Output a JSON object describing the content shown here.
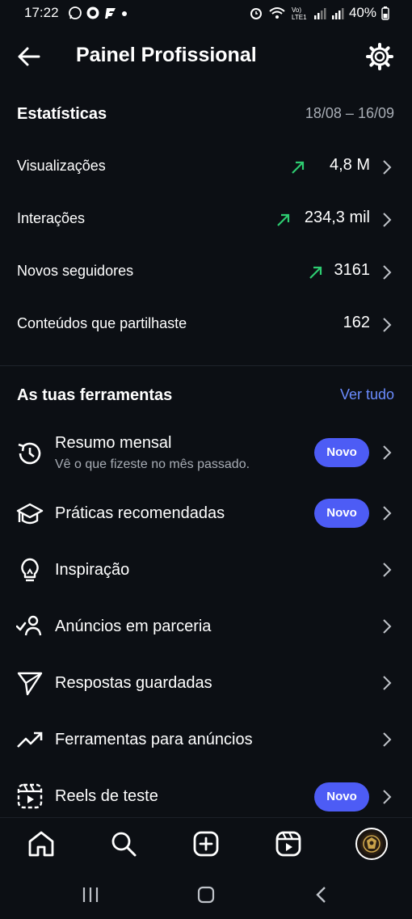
{
  "status_bar": {
    "time": "17:22",
    "battery": "40%"
  },
  "header": {
    "title": "Painel Profissional"
  },
  "stats": {
    "title": "Estatísticas",
    "date_range": "18/08 – 16/09",
    "rows": [
      {
        "label": "Visualizações",
        "value": "4,8 M",
        "trend": "up"
      },
      {
        "label": "Interações",
        "value": "234,3 mil",
        "trend": "up"
      },
      {
        "label": "Novos seguidores",
        "value": "3161",
        "trend": "up"
      },
      {
        "label": "Conteúdos que partilhaste",
        "value": "162",
        "trend": "none"
      }
    ]
  },
  "tools": {
    "title": "As tuas ferramentas",
    "see_all": "Ver tudo",
    "items": [
      {
        "label": "Resumo mensal",
        "subtitle": "Vê o que fizeste no mês passado.",
        "badge": "Novo",
        "icon": "history-icon"
      },
      {
        "label": "Práticas recomendadas",
        "badge": "Novo",
        "icon": "graduation-cap-icon"
      },
      {
        "label": "Inspiração",
        "icon": "lightbulb-icon"
      },
      {
        "label": "Anúncios em parceria",
        "icon": "person-check-icon"
      },
      {
        "label": "Respostas guardadas",
        "icon": "send-icon"
      },
      {
        "label": "Ferramentas para anúncios",
        "icon": "trending-up-icon"
      },
      {
        "label": "Reels de teste",
        "badge": "Novo",
        "icon": "reels-test-icon"
      }
    ]
  },
  "colors": {
    "background": "#0c0f14",
    "accent": "#4d5cf5",
    "link": "#6b8cff",
    "trend": "#2ecc71",
    "muted": "#a8adb5"
  },
  "bottom_nav": [
    "home-icon",
    "search-icon",
    "create-icon",
    "reels-icon",
    "profile-avatar"
  ]
}
